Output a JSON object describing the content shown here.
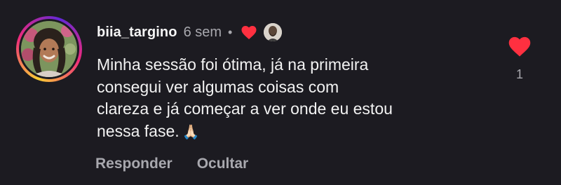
{
  "comment": {
    "username": "biia_targino",
    "time": "6 sem",
    "separator": "•",
    "text_lines": [
      "Minha sessão foi ótima, já na primeira",
      "consegui ver algumas coisas com",
      "clareza e já começar a ver onde eu estou",
      "nessa fase."
    ],
    "emoji": "🙏🏻",
    "liked_by_creator": true
  },
  "actions": {
    "reply_label": "Responder",
    "hide_label": "Ocultar"
  },
  "likes": {
    "count": "1",
    "liked": true
  },
  "colors": {
    "background": "#1c1b21",
    "heart": "#ff3040",
    "muted_text": "#a8a8ae",
    "primary_text": "#f5f5f5"
  },
  "icons": {
    "liked_heart": "heart-filled-icon",
    "like_button": "heart-filled-icon"
  }
}
